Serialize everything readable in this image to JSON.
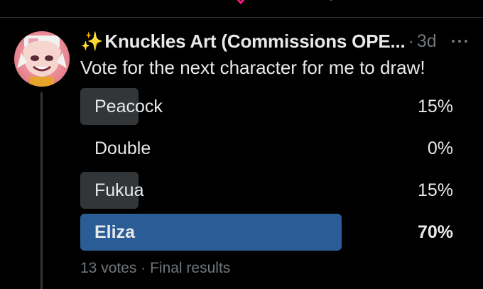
{
  "header": {
    "sparkle_icon": "sparkles-icon",
    "display_name": "Knuckles Art (Commissions OPE...",
    "separator": "·",
    "time_ago": "3d"
  },
  "post": {
    "text": "Vote for the next character for me to draw!"
  },
  "poll": {
    "options": [
      {
        "label": "Peacock",
        "percent_text": "15%",
        "percent": 15,
        "winner": false
      },
      {
        "label": "Double",
        "percent_text": "0%",
        "percent": 0,
        "winner": false
      },
      {
        "label": "Fukua",
        "percent_text": "15%",
        "percent": 15,
        "winner": false
      },
      {
        "label": "Eliza",
        "percent_text": "70%",
        "percent": 70,
        "winner": true
      }
    ],
    "votes": "13 votes",
    "separator": "·",
    "status": "Final results"
  },
  "colors": {
    "background": "#000000",
    "bar": "#333639",
    "winner_bar": "#2a5d95",
    "secondary_text": "#71767b",
    "primary_text": "#e7e9ea"
  }
}
